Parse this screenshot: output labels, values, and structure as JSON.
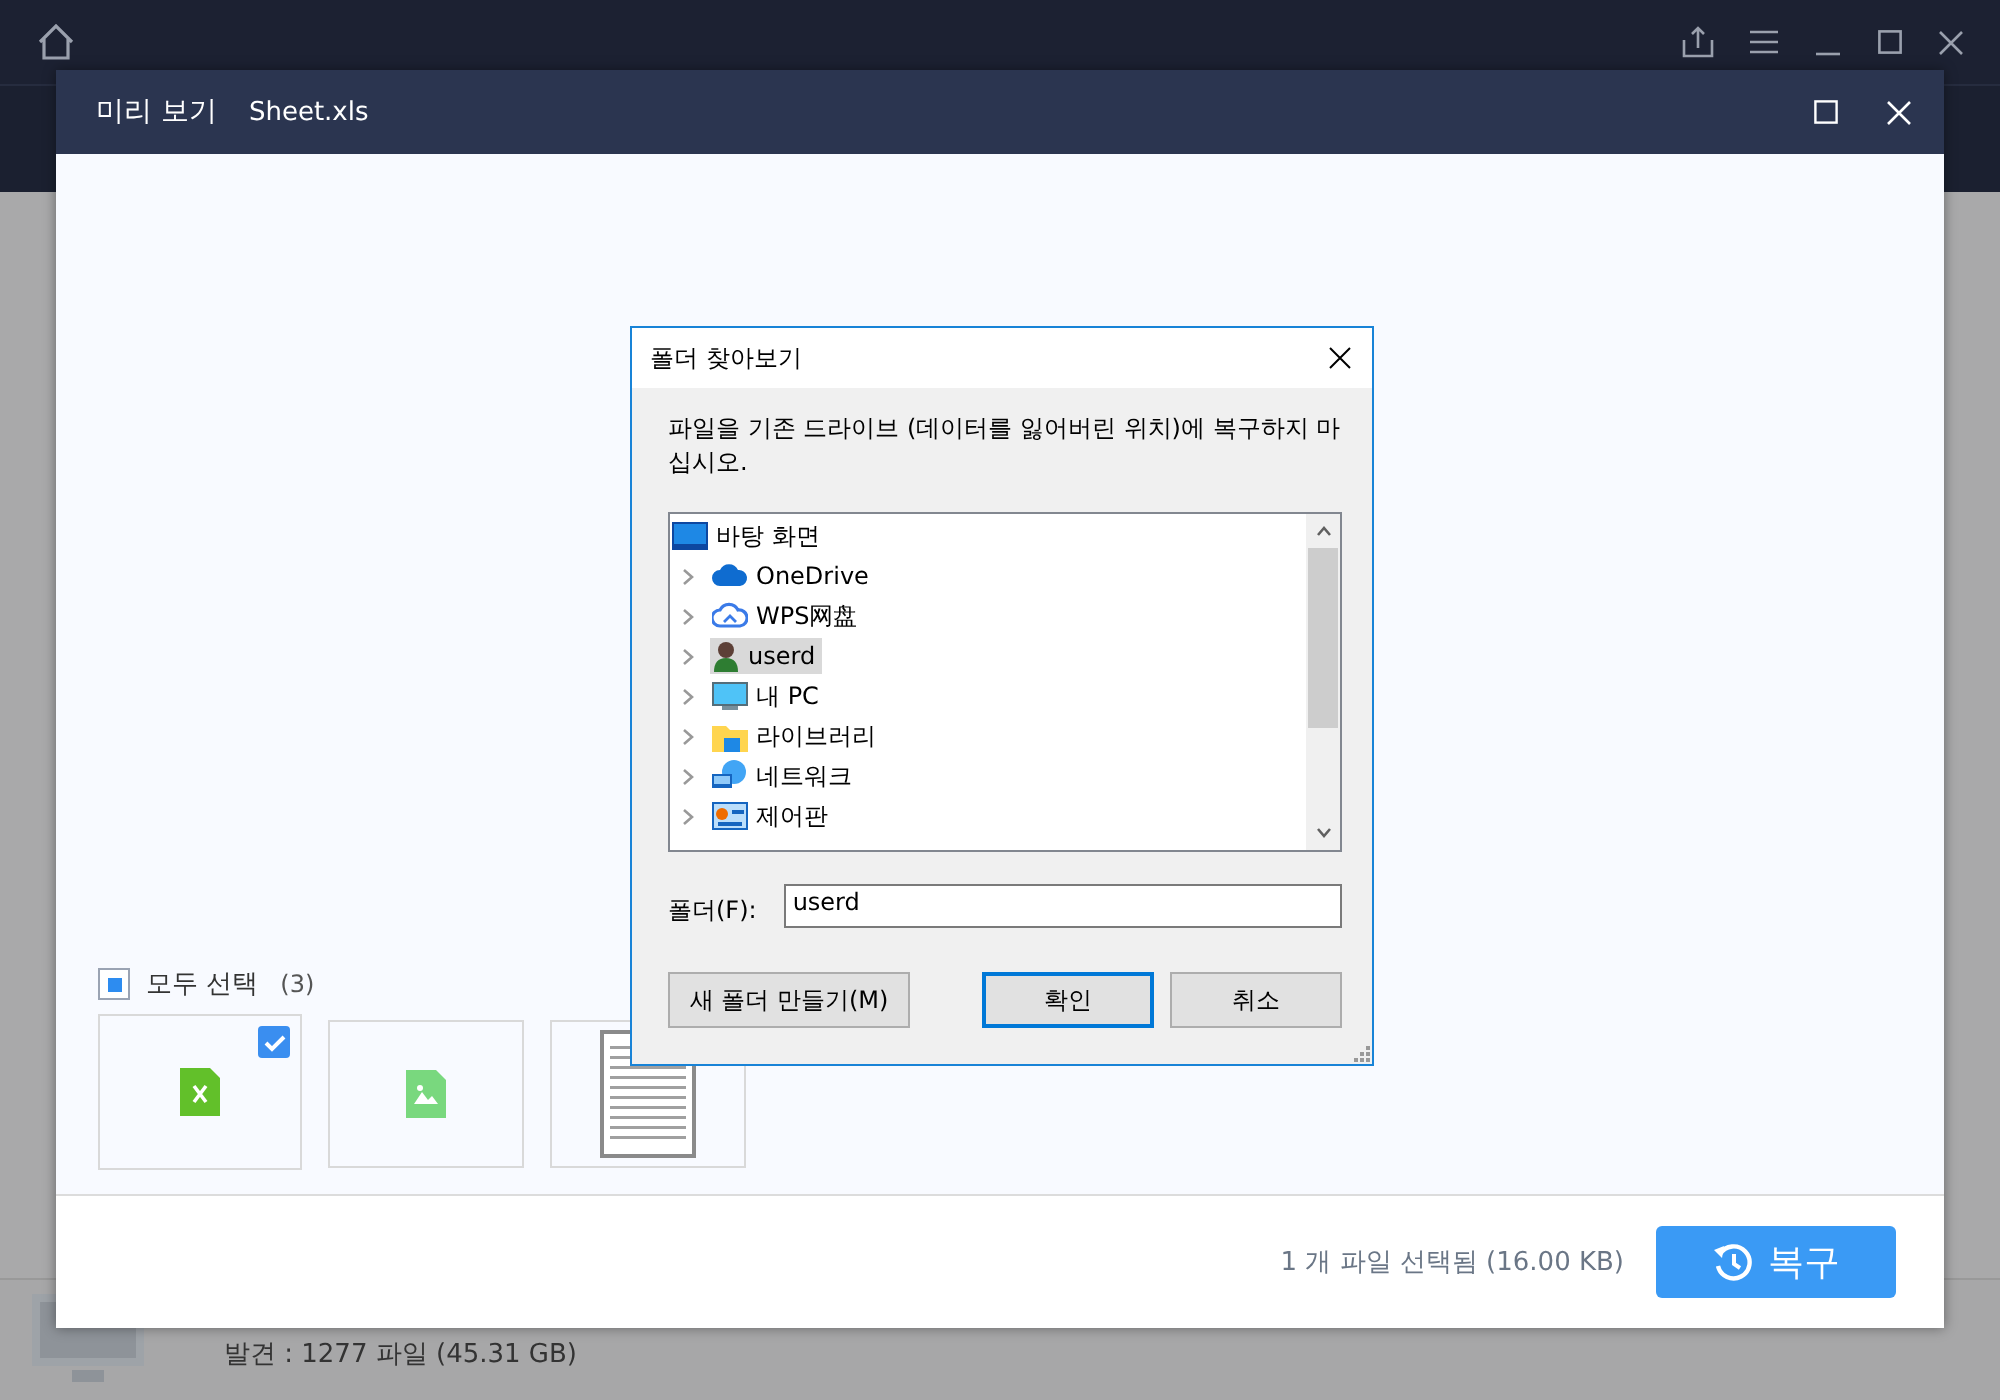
{
  "app": {
    "status": "발견 : 1277 파일 (45.31 GB)"
  },
  "preview": {
    "title": "미리 보기",
    "file": "Sheet.xls",
    "select_all": {
      "label": "모두 선택",
      "count": "(3)",
      "partial": true
    },
    "thumbnails": [
      {
        "kind": "excel",
        "selected": true
      },
      {
        "kind": "image",
        "selected": false
      },
      {
        "kind": "document",
        "selected": false
      }
    ],
    "summary": "1 개 파일 선택됨 (16.00 KB)",
    "recover_button": "복구"
  },
  "dialog": {
    "title": "폴더 찾아보기",
    "message": "파일을 기존 드라이브 (데이터를 잃어버린 위치)에 복구하지 마십시오.",
    "tree": [
      {
        "label": "바탕 화면",
        "kind": "desktop",
        "expandable": false,
        "selected": false
      },
      {
        "label": "OneDrive",
        "kind": "cloud",
        "expandable": true,
        "selected": false
      },
      {
        "label": "WPS网盘",
        "kind": "cloudoutline",
        "expandable": true,
        "selected": false
      },
      {
        "label": "userd",
        "kind": "user",
        "expandable": true,
        "selected": true
      },
      {
        "label": "내 PC",
        "kind": "monitor",
        "expandable": true,
        "selected": false
      },
      {
        "label": "라이브러리",
        "kind": "library",
        "expandable": true,
        "selected": false
      },
      {
        "label": "네트워크",
        "kind": "network",
        "expandable": true,
        "selected": false
      },
      {
        "label": "제어판",
        "kind": "control",
        "expandable": true,
        "selected": false
      }
    ],
    "folder_label": "폴더(F):",
    "folder_value": "userd",
    "buttons": [
      {
        "label": "새 폴더 만들기(M)",
        "default": false
      },
      {
        "label": "확인",
        "default": true
      },
      {
        "label": "취소",
        "default": false
      }
    ]
  }
}
